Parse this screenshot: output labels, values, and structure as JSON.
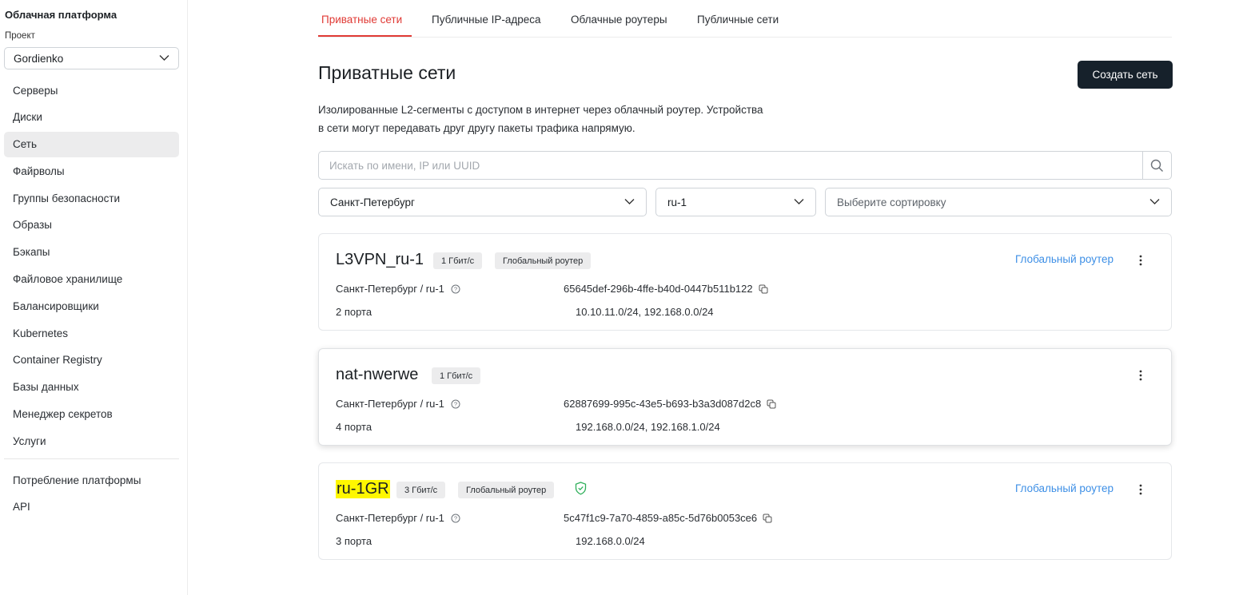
{
  "sidebar": {
    "title": "Облачная платформа",
    "project_label": "Проект",
    "project_value": "Gordienko",
    "items": [
      {
        "label": "Серверы"
      },
      {
        "label": "Диски"
      },
      {
        "label": "Сеть",
        "active": true
      },
      {
        "label": "Файрволы"
      },
      {
        "label": "Группы безопасности"
      },
      {
        "label": "Образы"
      },
      {
        "label": "Бэкапы"
      },
      {
        "label": "Файловое хранилище"
      },
      {
        "label": "Балансировщики"
      },
      {
        "label": "Kubernetes"
      },
      {
        "label": "Container Registry"
      },
      {
        "label": "Базы данных"
      },
      {
        "label": "Менеджер секретов"
      },
      {
        "label": "Услуги"
      }
    ],
    "items2": [
      {
        "label": "Потребление платформы"
      },
      {
        "label": "API"
      }
    ]
  },
  "tabs": [
    {
      "label": "Приватные сети",
      "active": true
    },
    {
      "label": "Публичные IP-адреса"
    },
    {
      "label": "Облачные роутеры"
    },
    {
      "label": "Публичные сети"
    }
  ],
  "page": {
    "title": "Приватные сети",
    "create_button": "Создать сеть",
    "description_line1": "Изолированные L2-сегменты с доступом в интернет через облачный роутер. Устройства",
    "description_line2": "в сети могут передавать друг другу пакеты трафика напрямую."
  },
  "search": {
    "placeholder": "Искать по имени, IP или UUID",
    "icon": "search-icon"
  },
  "filters": {
    "region": "Санкт-Петербург",
    "zone": "ru-1",
    "sort_placeholder": "Выберите сортировку"
  },
  "networks": [
    {
      "name": "L3VPN_ru-1",
      "speed": "1 Гбит/с",
      "router_badge": "Глобальный роутер",
      "location": "Санкт-Петербург / ru-1",
      "uuid": "65645def-296b-4ffe-b40d-0447b511b122",
      "ports": "2 порта",
      "subnets": "10.10.11.0/24, 192.168.0.0/24",
      "router_link": "Глобальный роутер"
    },
    {
      "name": "nat-nwerwe",
      "speed": "1 Гбит/с",
      "location": "Санкт-Петербург / ru-1",
      "uuid": "62887699-995c-43e5-b693-b3a3d087d2c8",
      "ports": "4 порта",
      "subnets": "192.168.0.0/24, 192.168.1.0/24"
    },
    {
      "name": "ru-1GR",
      "speed": "3 Гбит/с",
      "router_badge": "Глобальный роутер",
      "location": "Санкт-Петербург / ru-1",
      "uuid": "5c47f1c9-7a70-4859-a85c-5d76b0053ce6",
      "ports": "3 порта",
      "subnets": "192.168.0.0/24",
      "router_link": "Глобальный роутер",
      "status_icon": "shield-check-icon"
    }
  ],
  "colors": {
    "accent": "#e03a35",
    "primary_button": "#16212b",
    "link": "#3d8fe6",
    "highlight": "#fff700",
    "status_ok": "#2eaf5a"
  }
}
